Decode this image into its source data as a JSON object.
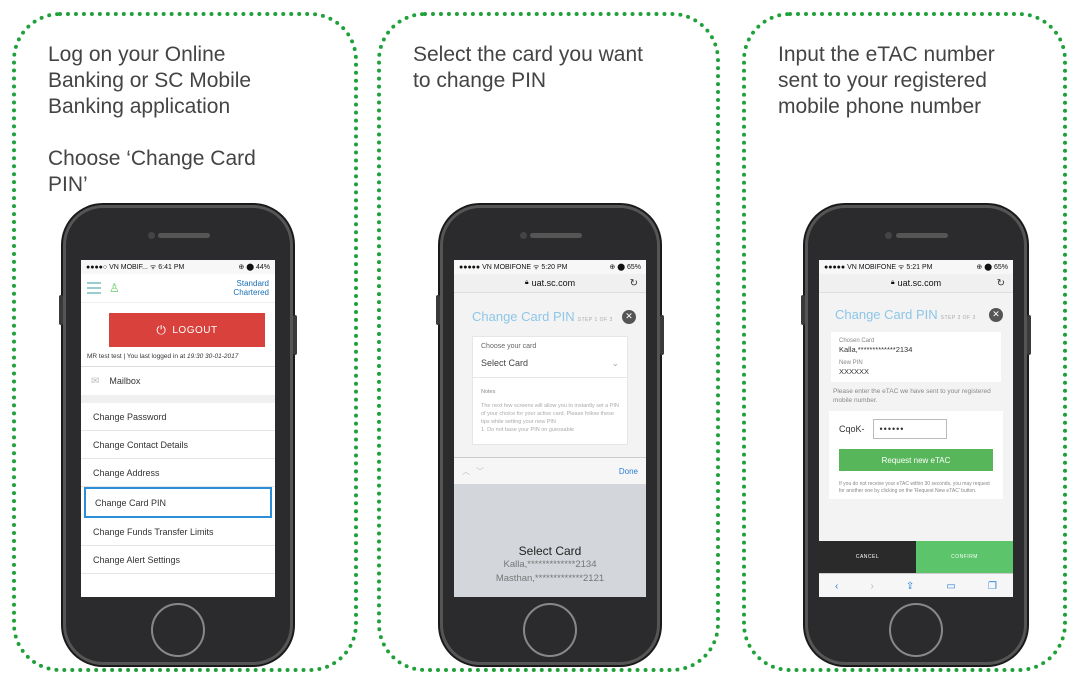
{
  "steps": [
    {
      "caption": "Log on your Online\nBanking or SC Mobile\nBanking application\n\nChoose ‘Change Card\nPIN’",
      "phone": {
        "status_left": "●●●●○ VN MOBIF...  ᯤ  6:41 PM",
        "status_right": "⊕ ⬤ 44%",
        "brand_line1": "Standard",
        "brand_line2": "Chartered",
        "logout_label": "LOGOUT",
        "last_login_text": "MR test test | You last logged in at",
        "last_login_time": "19:30 30-01-2017",
        "mailbox_label": "Mailbox",
        "menu_items": [
          "Change Password",
          "Change Contact Details",
          "Change Address",
          "Change Card PIN",
          "Change Funds Transfer Limits",
          "Change Alert Settings"
        ],
        "selected_item": "Change Card PIN"
      }
    },
    {
      "caption": "Select the card you want\nto change PIN",
      "phone": {
        "status_left": "●●●●● VN MOBIFONE  ᯤ  5:20 PM",
        "status_right": "⊕ ⬤ 65%",
        "url": "uat.sc.com",
        "title": "Change Card PIN",
        "step": "STEP 1 OF 3",
        "choose_label": "Choose your card",
        "select_label": "Select Card",
        "notes_title": "Notes",
        "notes_text": "The next few screens will allow you to instantly set a PIN of your choice for your active card. Please follow these tips while setting your new PIN",
        "notes_tip": "1.  Do not base your PIN on guessable",
        "done_label": "Done",
        "picker_title": "Select Card",
        "picker_options": [
          "Kalla,*************2134",
          "Masthan,*************2121"
        ]
      }
    },
    {
      "caption": "Input the eTAC number\nsent to your registered\nmobile phone number",
      "phone": {
        "status_left": "●●●●● VN MOBIFONE  ᯤ  5:21 PM",
        "status_right": "⊕ ⬤ 65%",
        "url": "uat.sc.com",
        "title": "Change Card PIN",
        "step": "STEP 3 OF 3",
        "chosen_card_label": "Chosen Card",
        "chosen_card_value": "Kalla,*************2134",
        "new_pin_label": "New PIN",
        "new_pin_value": "XXXXXX",
        "etac_message": "Please enter the eTAC we have sent to your registered mobile number.",
        "etac_prefix": "CqoK-",
        "etac_value": "••••••",
        "request_label": "Request new eTAC",
        "resend_note": "If you do not receive your eTAC within 30 seconds, you may request for another one by clicking on the 'Request New eTAC' button.",
        "cancel_label": "CANCEL",
        "confirm_label": "CONFIRM"
      }
    }
  ],
  "colors": {
    "border": "#1fa13a",
    "logout": "#d9413c",
    "accent_blue": "#2a8fd8",
    "green_button": "#57b65a"
  }
}
